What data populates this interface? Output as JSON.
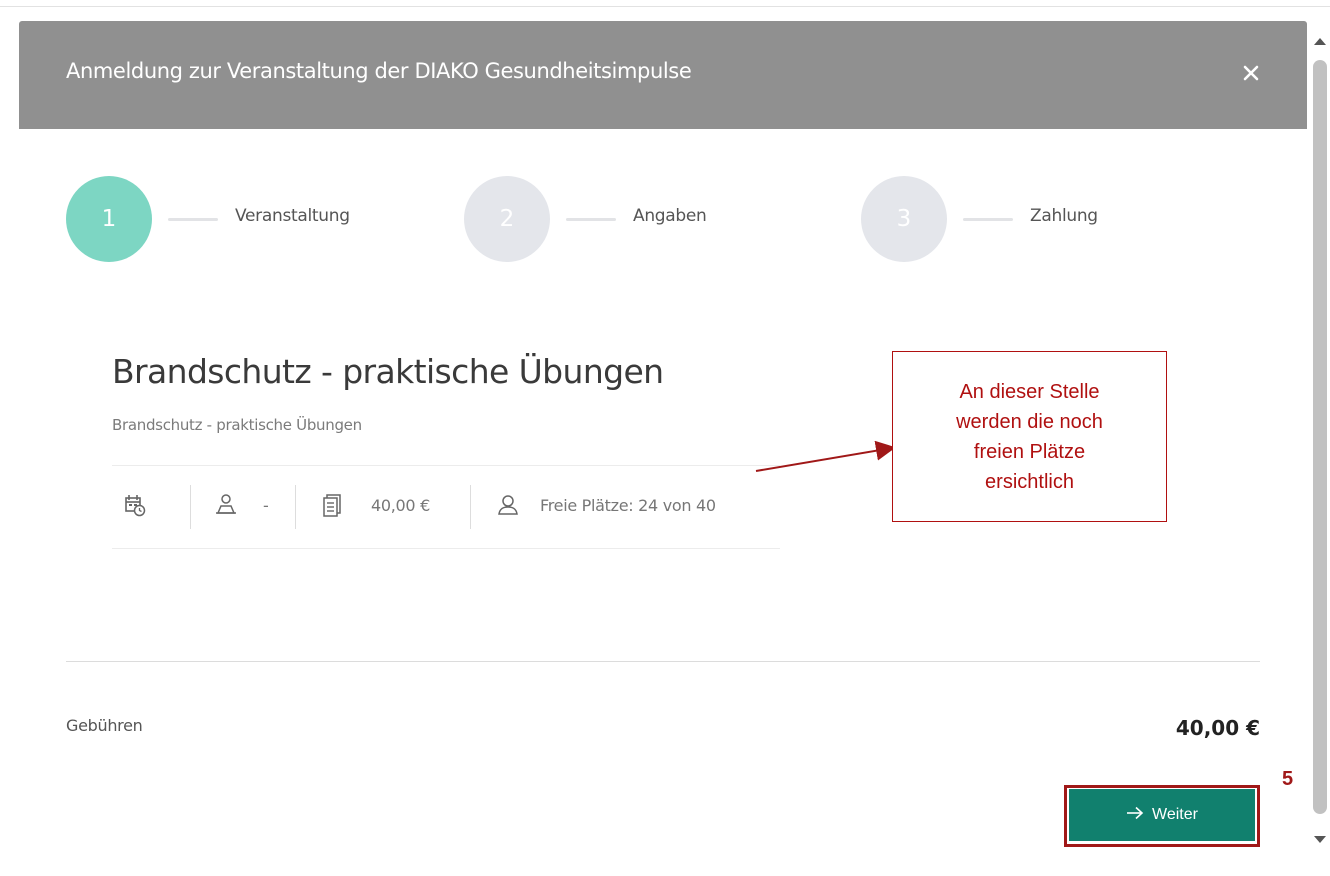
{
  "modal": {
    "title": "Anmeldung zur Veranstaltung der DIAKO Gesundheitsimpulse",
    "close_icon": "close-icon"
  },
  "steps": [
    {
      "number": "1",
      "label": "Veranstaltung",
      "state": "active"
    },
    {
      "number": "2",
      "label": "Angaben",
      "state": "inactive"
    },
    {
      "number": "3",
      "label": "Zahlung",
      "state": "inactive"
    }
  ],
  "event": {
    "title": "Brandschutz - praktische Übungen",
    "subtitle": "Brandschutz - praktische Übungen",
    "info": {
      "date_icon": "calendar-clock-icon",
      "location_icon": "map-person-icon",
      "location_text": "-",
      "price_icon": "price-list-icon",
      "price_text": "40,00 €",
      "seats_icon": "person-icon",
      "seats_text": "Freie Plätze: 24 von 40"
    }
  },
  "annotation": {
    "callout_lines": [
      "An dieser Stelle",
      "werden die noch",
      "freien Plätze",
      "ersichtlich"
    ],
    "step_number": "5"
  },
  "footer": {
    "fees_label": "Gebühren",
    "fees_value": "40,00 €",
    "next_button_label": "Weiter",
    "next_icon": "arrow-right-icon"
  },
  "colors": {
    "header_bg": "#909090",
    "step_active": "#7dd6c3",
    "step_inactive": "#e4e6eb",
    "button_bg": "#11806e",
    "annotation": "#b01010"
  }
}
